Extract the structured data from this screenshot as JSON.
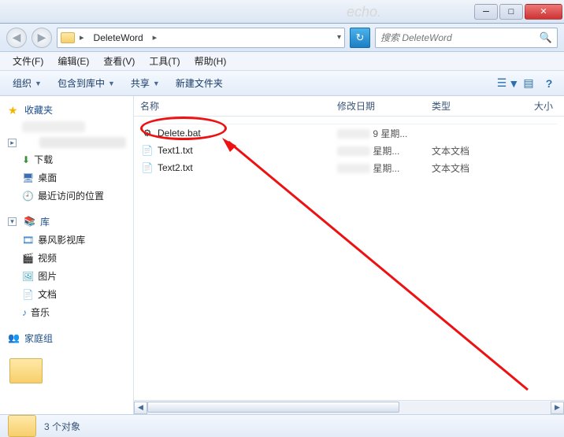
{
  "titlebar": {
    "echo_text": "echo."
  },
  "nav": {
    "folder_name": "DeleteWord",
    "search_placeholder": "搜索 DeleteWord"
  },
  "menubar": {
    "file": "文件(F)",
    "edit": "编辑(E)",
    "view": "查看(V)",
    "tools": "工具(T)",
    "help": "帮助(H)"
  },
  "toolbar": {
    "organize": "组织",
    "include": "包含到库中",
    "share": "共享",
    "newfolder": "新建文件夹"
  },
  "sidebar": {
    "favorites": "收藏夹",
    "downloads": "下载",
    "desktop": "桌面",
    "recent": "最近访问的位置",
    "libraries": "库",
    "baofeng": "暴风影视库",
    "videos": "视频",
    "pictures": "图片",
    "documents": "文档",
    "music": "音乐",
    "homegroup": "家庭组"
  },
  "columns": {
    "name": "名称",
    "date": "修改日期",
    "type": "类型",
    "size": "大小"
  },
  "files": [
    {
      "name": "Delete.bat",
      "date_suffix": "9 星期...",
      "type": ""
    },
    {
      "name": "Text1.txt",
      "date_suffix": "星期...",
      "type": "文本文档"
    },
    {
      "name": "Text2.txt",
      "date_suffix": "星期...",
      "type": "文本文档"
    }
  ],
  "status": {
    "count_text": "3 个对象"
  }
}
